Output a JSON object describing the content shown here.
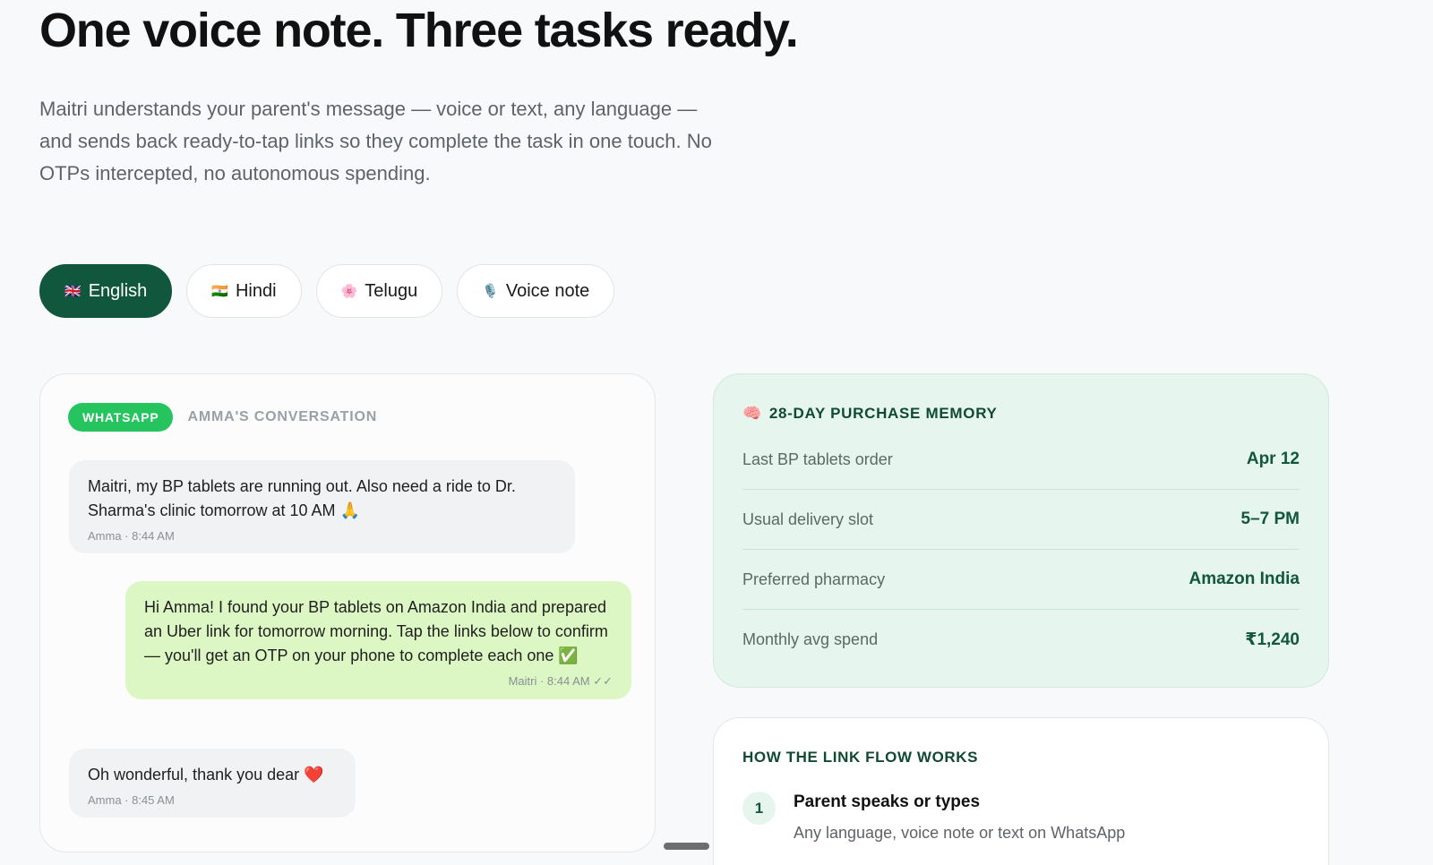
{
  "hero": {
    "headline": "One voice note. Three tasks ready.",
    "intro": "Maitri understands your parent's message — voice or text, any language — and sends back ready-to-tap links so they complete the task in one touch. No OTPs intercepted, no autonomous spending."
  },
  "language_tabs": [
    {
      "flag": "🇬🇧",
      "label": "English",
      "active": true
    },
    {
      "flag": "🇮🇳",
      "label": "Hindi",
      "active": false
    },
    {
      "flag": "🌸",
      "label": "Telugu",
      "active": false
    },
    {
      "flag": "🎙️",
      "label": "Voice note",
      "active": false
    }
  ],
  "chat": {
    "badge": "WHATSAPP",
    "title": "AMMA'S CONVERSATION",
    "messages": [
      {
        "direction": "in",
        "text": "Maitri, my BP tablets are running out. Also need a ride to Dr. Sharma's clinic tomorrow at 10 AM 🙏",
        "meta": "Amma · 8:44 AM"
      },
      {
        "direction": "out",
        "text": "Hi Amma! I found your BP tablets on Amazon India and prepared an Uber link for tomorrow morning. Tap the links below to confirm — you'll get an OTP on your phone to complete each one ✅",
        "meta": "Maitri · 8:44 AM ✓✓"
      },
      {
        "direction": "in",
        "text": "Oh wonderful, thank you dear ❤️",
        "meta": "Amma · 8:45 AM"
      }
    ]
  },
  "memory": {
    "icon": "🧠",
    "title": "28-DAY PURCHASE MEMORY",
    "rows": [
      {
        "label": "Last BP tablets order",
        "value": "Apr 12"
      },
      {
        "label": "Usual delivery slot",
        "value": "5–7 PM"
      },
      {
        "label": "Preferred pharmacy",
        "value": "Amazon India"
      },
      {
        "label": "Monthly avg spend",
        "value": "₹1,240"
      }
    ]
  },
  "flow": {
    "title": "HOW THE LINK FLOW WORKS",
    "steps": [
      {
        "number": "1",
        "title": "Parent speaks or types",
        "description": "Any language, voice note or text on WhatsApp"
      }
    ]
  },
  "colors": {
    "brand_green": "#11573d",
    "whatsapp_green": "#25c45f",
    "outgoing_bubble": "#dcf7c4",
    "memory_bg": "#e6f5ed"
  }
}
